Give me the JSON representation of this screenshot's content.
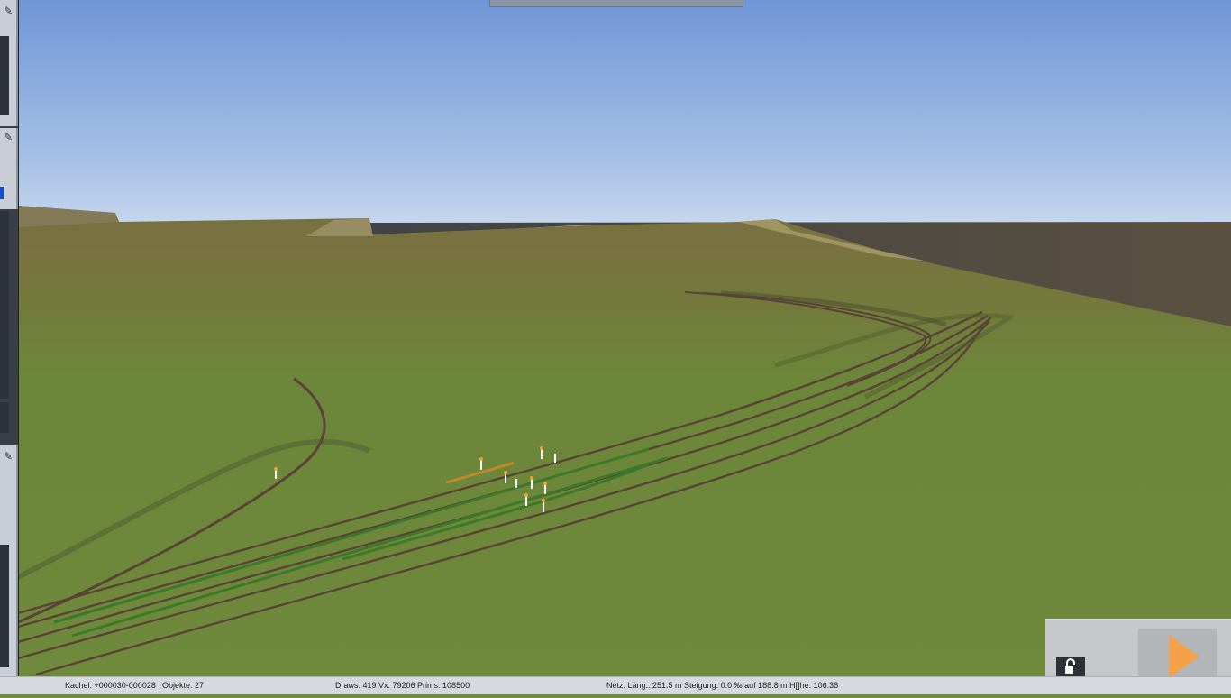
{
  "status": {
    "tile": "Kachel: +000030-000028",
    "objects": "Objekte: 27",
    "render": "Draws: 419 Vx: 79206 Prims: 108500",
    "network": "Netz:  Läng.:  251.5 m Steigung:  0.0 ‰ auf 188.8 m H[]he: 106.38"
  },
  "icons": {
    "pin": "pin-icon",
    "play": "play-icon",
    "lock": "unlock-icon"
  },
  "colors": {
    "sky_top": "#6f96d6",
    "sky_horizon": "#c6d8ee",
    "grass": "#6f8a3c",
    "track": "#5a4336",
    "track_highlight": "#3c7a2a",
    "play_accent": "#f5a04a"
  }
}
